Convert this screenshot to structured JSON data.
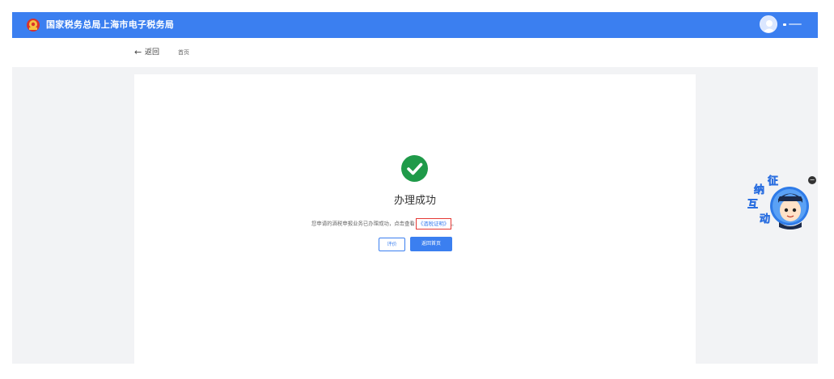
{
  "header": {
    "title": "国家税务总局上海市电子税务局",
    "user_name": ""
  },
  "breadcrumb": {
    "back_icon": "←",
    "back_label": "返回",
    "home_label": "首页"
  },
  "result": {
    "title": "办理成功",
    "message": "您申请的酒税申报业务已办理成功，点击查看",
    "link_label": "《酒税证明》",
    "message_end": "。"
  },
  "actions": {
    "evaluate_label": "评价",
    "home_label": "返回首页"
  },
  "widget": {
    "chars": [
      "纳",
      "征",
      "互",
      "动"
    ],
    "close_symbol": "−"
  },
  "colors": {
    "primary": "#3b7ff0",
    "success": "#1f9a49",
    "highlight_border": "#e53935",
    "page_bg": "#f2f3f5"
  },
  "icons": {
    "success": "check-circle-icon",
    "back": "arrow-left-icon",
    "emblem": "tax-emblem-icon",
    "avatar": "user-avatar-icon"
  }
}
